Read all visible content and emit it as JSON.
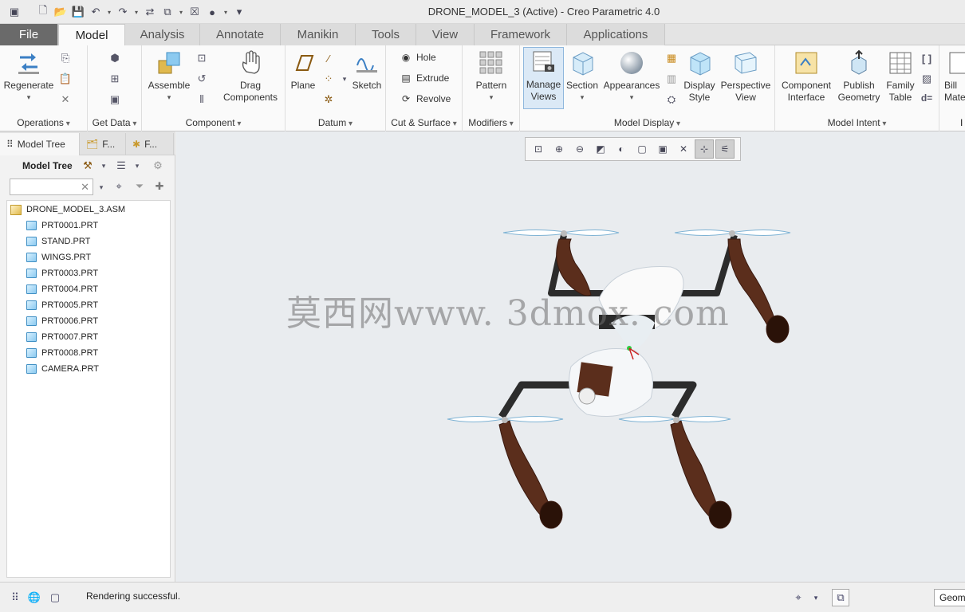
{
  "window": {
    "title": "DRONE_MODEL_3 (Active) - Creo Parametric 4.0"
  },
  "ribbon_tabs": [
    "File",
    "Model",
    "Analysis",
    "Annotate",
    "Manikin",
    "Tools",
    "View",
    "Framework",
    "Applications"
  ],
  "active_tab": "Model",
  "ribbon": {
    "operations": {
      "label": "Operations",
      "regenerate": "Regenerate"
    },
    "get_data": {
      "label": "Get Data"
    },
    "component": {
      "label": "Component",
      "assemble": "Assemble",
      "drag_1": "Drag",
      "drag_2": "Components"
    },
    "datum": {
      "label": "Datum",
      "plane": "Plane",
      "sketch": "Sketch"
    },
    "cut_surface": {
      "label": "Cut & Surface",
      "hole": "Hole",
      "extrude": "Extrude",
      "revolve": "Revolve"
    },
    "modifiers": {
      "label": "Modifiers",
      "pattern": "Pattern"
    },
    "model_display": {
      "label": "Model Display",
      "manage_views_1": "Manage",
      "manage_views_2": "Views",
      "section": "Section",
      "appearances": "Appearances",
      "display_style_1": "Display",
      "display_style_2": "Style",
      "perspective_1": "Perspective",
      "perspective_2": "View"
    },
    "model_intent": {
      "label": "Model Intent",
      "component_interface_1": "Component",
      "component_interface_2": "Interface",
      "publish_1": "Publish",
      "publish_2": "Geometry",
      "family_1": "Family",
      "family_2": "Table",
      "d_equals": "d="
    },
    "overflow": {
      "bill_1": "Bill",
      "bill_2": "Mate",
      "group_initial": "I"
    }
  },
  "left_panel": {
    "tabs": [
      "Model Tree",
      "F...",
      "F..."
    ],
    "tree_title": "Model Tree",
    "search_placeholder": "",
    "root": "DRONE_MODEL_3.ASM",
    "parts": [
      "PRT0001.PRT",
      "STAND.PRT",
      "WINGS.PRT",
      "PRT0003.PRT",
      "PRT0004.PRT",
      "PRT0005.PRT",
      "PRT0006.PRT",
      "PRT0007.PRT",
      "PRT0008.PRT",
      "CAMERA.PRT"
    ]
  },
  "graphics": {
    "watermark": "莫西网www. 3dmox. com"
  },
  "status": {
    "message": "Rendering successful.",
    "filter_value": "Geometry"
  },
  "colors": {
    "file_tab": "#6a6a6a",
    "arms": "#333333",
    "legs": "#5b2e1c",
    "body": "#ffffff",
    "background": "#e9ecef"
  }
}
